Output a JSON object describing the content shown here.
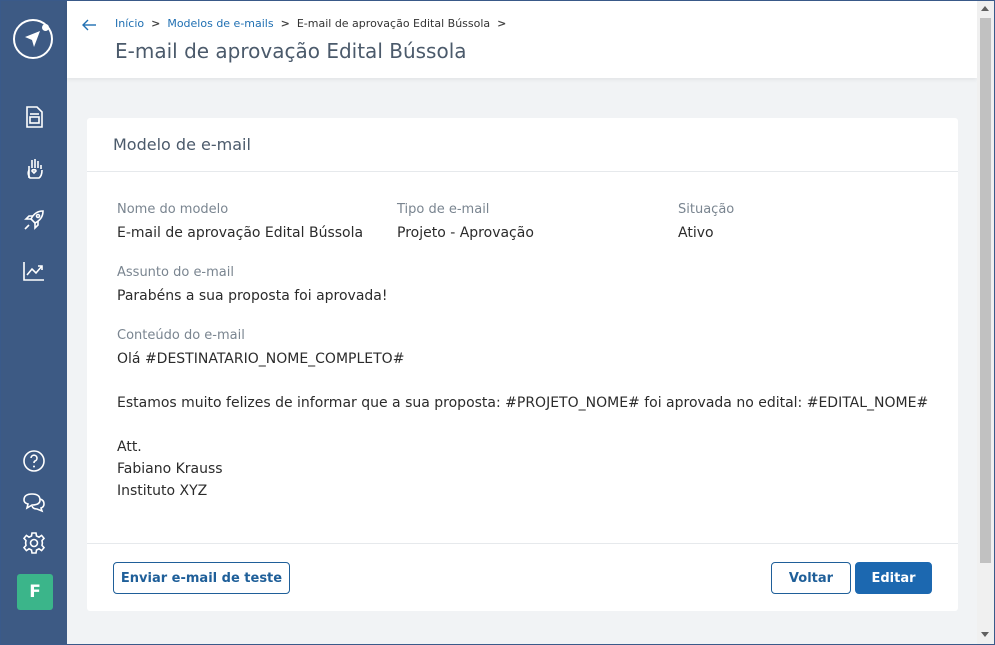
{
  "breadcrumb": {
    "items": [
      "Início",
      "Modelos de e-mails",
      "E-mail de aprovação Edital Bússola"
    ],
    "separator": ">"
  },
  "page": {
    "title": "E-mail de aprovação Edital Bússola"
  },
  "card": {
    "title": "Modelo de e-mail",
    "fields": {
      "nome_label": "Nome do modelo",
      "nome_value": "E-mail de aprovação Edital Bússola",
      "tipo_label": "Tipo de e-mail",
      "tipo_value": "Projeto - Aprovação",
      "situacao_label": "Situação",
      "situacao_value": "Ativo",
      "assunto_label": "Assunto do e-mail",
      "assunto_value": "Parabéns a sua proposta foi aprovada!",
      "conteudo_label": "Conteúdo do e-mail"
    },
    "content_lines": [
      "Olá #DESTINATARIO_NOME_COMPLETO#",
      "Estamos muito felizes de informar que a sua proposta: #PROJETO_NOME# foi aprovada no edital: #EDITAL_NOME#",
      "Att.",
      "Fabiano Krauss",
      "Instituto XYZ"
    ]
  },
  "actions": {
    "test_label": "Enviar e-mail de teste",
    "back_label": "Voltar",
    "edit_label": "Editar"
  },
  "user": {
    "avatar_initial": "F"
  },
  "sidebar": {
    "icons": [
      "document-icon",
      "hand-heart-icon",
      "rocket-icon",
      "chart-icon",
      "help-icon",
      "chat-icon",
      "settings-icon"
    ]
  },
  "colors": {
    "sidebar": "#3d5a84",
    "primary": "#1c68b0",
    "link": "#1f6fb2",
    "avatar": "#3bb58a"
  }
}
